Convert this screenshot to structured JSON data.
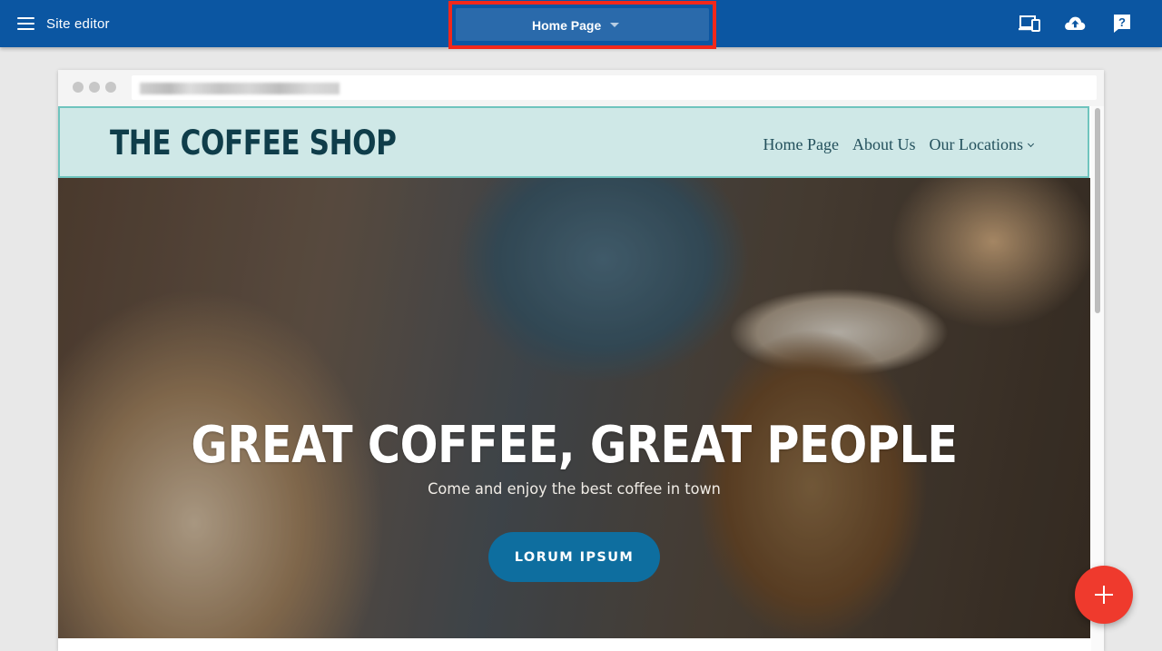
{
  "editor": {
    "title": "Site editor",
    "page_selector": {
      "selected": "Home Page"
    },
    "tools": [
      "devices-icon",
      "cloud-upload-icon",
      "help-icon"
    ]
  },
  "site": {
    "logo": "THE COFFEE SHOP",
    "nav": [
      "Home Page",
      "About Us",
      "Our Locations"
    ],
    "hero": {
      "title": "GREAT COFFEE, GREAT PEOPLE",
      "subtitle": "Come and enjoy the best coffee in town",
      "button": "LORUM IPSUM"
    }
  },
  "colors": {
    "editor_bar": "#0b56a2",
    "highlight": "#f2281b",
    "site_header": "#cfe8e7",
    "hero_button": "#0e6e9f",
    "fab": "#ef3a2d"
  }
}
